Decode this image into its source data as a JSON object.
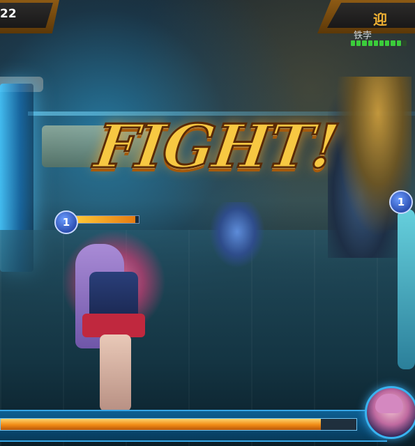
{
  "hud": {
    "timer": "22",
    "opponent_label": "迎",
    "enemy_name": "铁孛",
    "enemy_hp": {
      "segments": 10,
      "filled": 9
    }
  },
  "banner": {
    "text": "FIGHT!"
  },
  "units": {
    "player": {
      "level": "1",
      "hp_fraction": 0.95
    },
    "ally": {
      "level": "1"
    }
  },
  "player_hud": {
    "hp_fraction": 0.9
  },
  "colors": {
    "accent_gold": "#f1b233",
    "hp_orange": "#f08a14",
    "frame_blue": "#37a6e6",
    "enemy_hp_green": "#3bcc3b"
  },
  "icons": {
    "portrait": "character-portrait-icon"
  }
}
